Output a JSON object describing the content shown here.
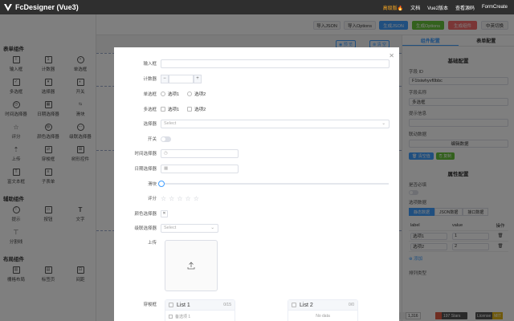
{
  "topbar": {
    "logo_text": "FcDesigner (Vue3)",
    "nav": [
      "高级版🔥",
      "文档",
      "Vue2版本",
      "查看源码",
      "FormCreate"
    ]
  },
  "sidebar": {
    "sections": [
      {
        "title": "表单组件",
        "items": [
          {
            "label": "输入框",
            "icon": "input-icon"
          },
          {
            "label": "计数器",
            "icon": "counter-icon"
          },
          {
            "label": "单选框",
            "icon": "radio-icon"
          },
          {
            "label": "多选框",
            "icon": "checkbox-icon"
          },
          {
            "label": "选择器",
            "icon": "select-icon"
          },
          {
            "label": "开关",
            "icon": "switch-icon"
          },
          {
            "label": "时间选择器",
            "icon": "clock-icon"
          },
          {
            "label": "日期选择器",
            "icon": "calendar-icon"
          },
          {
            "label": "滑块",
            "icon": "slider-icon"
          },
          {
            "label": "评分",
            "icon": "star-icon"
          },
          {
            "label": "颜色选择器",
            "icon": "palette-icon"
          },
          {
            "label": "级联选择器",
            "icon": "cascader-icon"
          },
          {
            "label": "上传",
            "icon": "upload-icon"
          },
          {
            "label": "穿梭框",
            "icon": "transfer-icon"
          },
          {
            "label": "树形控件",
            "icon": "tree-icon"
          },
          {
            "label": "富文本框",
            "icon": "richtext-icon"
          },
          {
            "label": "子表单",
            "icon": "subform-icon"
          }
        ]
      },
      {
        "title": "辅助组件",
        "items": [
          {
            "label": "提示",
            "icon": "info-icon"
          },
          {
            "label": "按钮",
            "icon": "button-icon"
          },
          {
            "label": "文字",
            "icon": "text-icon"
          },
          {
            "label": "分割线",
            "icon": "divider-icon"
          }
        ]
      },
      {
        "title": "布局组件",
        "items": [
          {
            "label": "栅格布局",
            "icon": "grid-icon"
          },
          {
            "label": "标签页",
            "icon": "tabs-icon"
          },
          {
            "label": "间距",
            "icon": "space-icon"
          }
        ]
      }
    ]
  },
  "toolbar": {
    "import_json": "导入JSON",
    "import_options": "导入Options",
    "gen_json": "生成JSON",
    "gen_options": "生成Options",
    "gen_component": "生成组件",
    "lang_switch": "中英切换"
  },
  "canvas": {
    "preview": "◉ 预 览",
    "clear": "⊗ 清 空"
  },
  "right_panel": {
    "tabs": [
      "组件配置",
      "表单配置"
    ],
    "basic_title": "基础配置",
    "field_id_label": "字段 ID",
    "field_id_value": "F1tsiwhyvf0bbc",
    "field_name_label": "字段名称",
    "field_name_value": "多选框",
    "hint_label": "提示信息",
    "linkage_label": "联动数据",
    "linkage_value": "编辑数据",
    "clear_btn": "🗑 清空值",
    "copy_btn": "⎘ 复制",
    "prop_title": "属性配置",
    "required_label": "是否必填",
    "options_label": "选项数据",
    "seg": [
      "静态数据",
      "JSON数据",
      "接口数据"
    ],
    "table_head": [
      "label",
      "value",
      "操作"
    ],
    "rows": [
      [
        "选项1",
        "1"
      ],
      [
        "选项2",
        "2"
      ]
    ],
    "add_label": "⊕ 添加",
    "layout_label": "排列类型"
  },
  "modal": {
    "fields": {
      "input": "输入框",
      "counter": "计数器",
      "radio": "单选框",
      "checkbox": "多选框",
      "select": "选择器",
      "switch": "开关",
      "time": "时间选择器",
      "date": "日期选择器",
      "slider": "滑块",
      "rate": "评分",
      "color": "颜色选择器",
      "cascader": "级联选择器",
      "upload": "上传",
      "transfer": "穿梭框"
    },
    "option1": "选项1",
    "option2": "选项2",
    "select_placeholder": "Select",
    "stepper_minus": "−",
    "stepper_plus": "+",
    "time_icon": "◷",
    "date_icon": "▦",
    "list1": "List 1",
    "list1_count": "0/15",
    "list2": "List 2",
    "list2_count": "0/0",
    "list1_item": "备选项 1",
    "no_data": "No data",
    "rate_value": 0
  },
  "badges": {
    "stars_count": "1,316",
    "stars_label": "197 Stars",
    "license": "License",
    "license_value": "MIT"
  }
}
